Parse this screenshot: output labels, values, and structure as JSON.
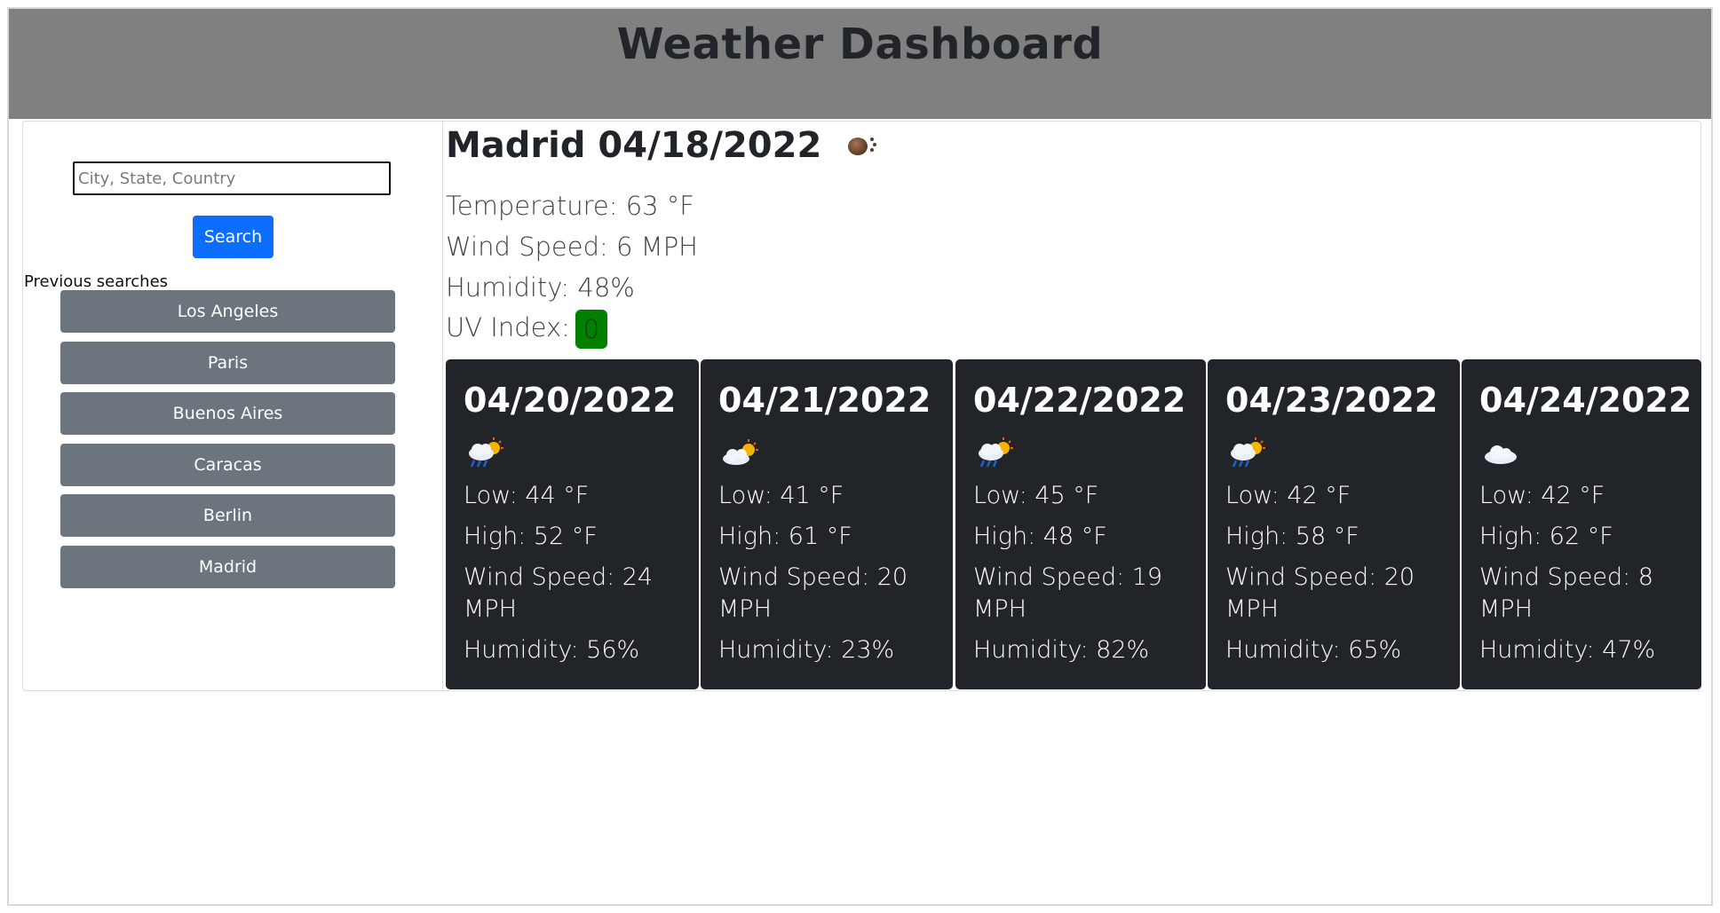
{
  "header": {
    "title": "Weather Dashboard"
  },
  "search": {
    "placeholder": "City, State, Country",
    "button_label": "Search"
  },
  "history": {
    "label": "Previous searches",
    "items": [
      "Los Angeles",
      "Paris",
      "Buenos Aires",
      "Caracas",
      "Berlin",
      "Madrid"
    ]
  },
  "current": {
    "title": "Madrid 04/18/2022",
    "icon": "haze-icon",
    "temperature": "Temperature: 63 °F",
    "wind": "Wind Speed: 6 MPH",
    "humidity": "Humidity: 48%",
    "uv_label": "UV Index:",
    "uv_value": "0",
    "uv_color": "#008000"
  },
  "forecast": [
    {
      "date": "04/20/2022",
      "icon": "rain-sun-icon",
      "low": "Low: 44 °F",
      "high": "High: 52 °F",
      "wind": "Wind Speed: 24 MPH",
      "humidity": "Humidity: 56%"
    },
    {
      "date": "04/21/2022",
      "icon": "partly-cloudy-icon",
      "low": "Low: 41 °F",
      "high": "High: 61 °F",
      "wind": "Wind Speed: 20 MPH",
      "humidity": "Humidity: 23%"
    },
    {
      "date": "04/22/2022",
      "icon": "rain-sun-icon",
      "low": "Low: 45 °F",
      "high": "High: 48 °F",
      "wind": "Wind Speed: 19 MPH",
      "humidity": "Humidity: 82%"
    },
    {
      "date": "04/23/2022",
      "icon": "rain-sun-icon",
      "low": "Low: 42 °F",
      "high": "High: 58 °F",
      "wind": "Wind Speed: 20 MPH",
      "humidity": "Humidity: 65%"
    },
    {
      "date": "04/24/2022",
      "icon": "cloud-icon",
      "low": "Low: 42 °F",
      "high": "High: 62 °F",
      "wind": "Wind Speed: 8 MPH",
      "humidity": "Humidity: 47%"
    }
  ]
}
